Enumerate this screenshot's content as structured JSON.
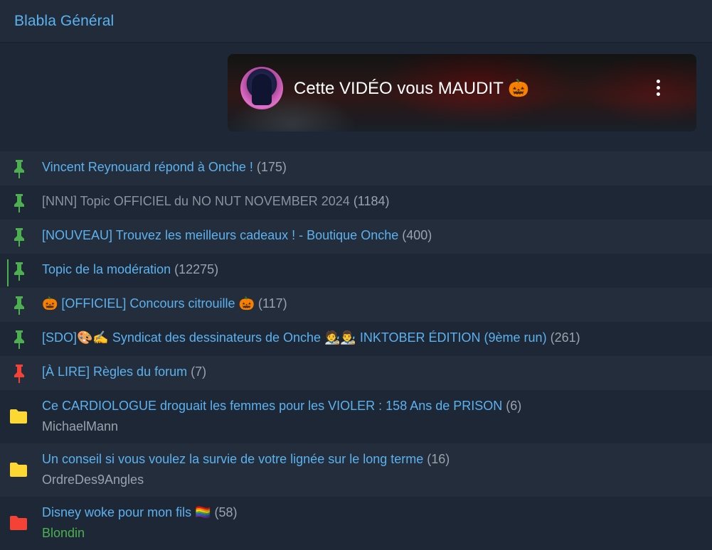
{
  "forum": {
    "title": "Blabla Général"
  },
  "video": {
    "title": "Cette VIDÉO vous MAUDIT 🎃"
  },
  "colors": {
    "link": "#5bb2ef",
    "pin_green": "#4caf50",
    "pin_red": "#f44336",
    "folder_yellow": "#fdd835",
    "folder_red": "#f44336"
  },
  "pinned": [
    {
      "title": "Vincent Reynouard répond à Onche !",
      "count": "(175)",
      "pin_color": "green",
      "grey": false
    },
    {
      "title": "[NNN] Topic OFFICIEL du NO NUT NOVEMBER 2024",
      "count": "(1184)",
      "pin_color": "green",
      "grey": true
    },
    {
      "title": "[NOUVEAU] Trouvez les meilleurs cadeaux ! - Boutique Onche",
      "count": "(400)",
      "pin_color": "green",
      "grey": false
    },
    {
      "title": "Topic de la modération",
      "count": "(12275)",
      "pin_color": "green",
      "grey": false
    },
    {
      "title": "🎃 [OFFICIEL] Concours citrouille 🎃",
      "count": "(117)",
      "pin_color": "green",
      "grey": false
    },
    {
      "title": "[SDO]🎨✍️ Syndicat des dessinateurs de Onche 🧑‍🎨👨‍🎨 INKTOBER ÉDITION (9ème run)",
      "count": "(261)",
      "pin_color": "green",
      "grey": false
    },
    {
      "title": "[À LIRE] Règles du forum",
      "count": "(7)",
      "pin_color": "red",
      "grey": false
    }
  ],
  "topics": [
    {
      "title": "Ce CARDIOLOGUE droguait les femmes pour les VIOLER : 158 Ans de PRISON",
      "count": "(6)",
      "author": "MichaelMann",
      "folder_color": "yellow",
      "author_green": false
    },
    {
      "title": "Un conseil si vous voulez la survie de votre lignée sur le long terme",
      "count": "(16)",
      "author": "OrdreDes9Angles",
      "folder_color": "yellow",
      "author_green": false
    },
    {
      "title": "Disney woke pour mon fils 🏳️‍🌈",
      "count": "(58)",
      "author": "Blondin",
      "folder_color": "red",
      "author_green": true
    }
  ]
}
